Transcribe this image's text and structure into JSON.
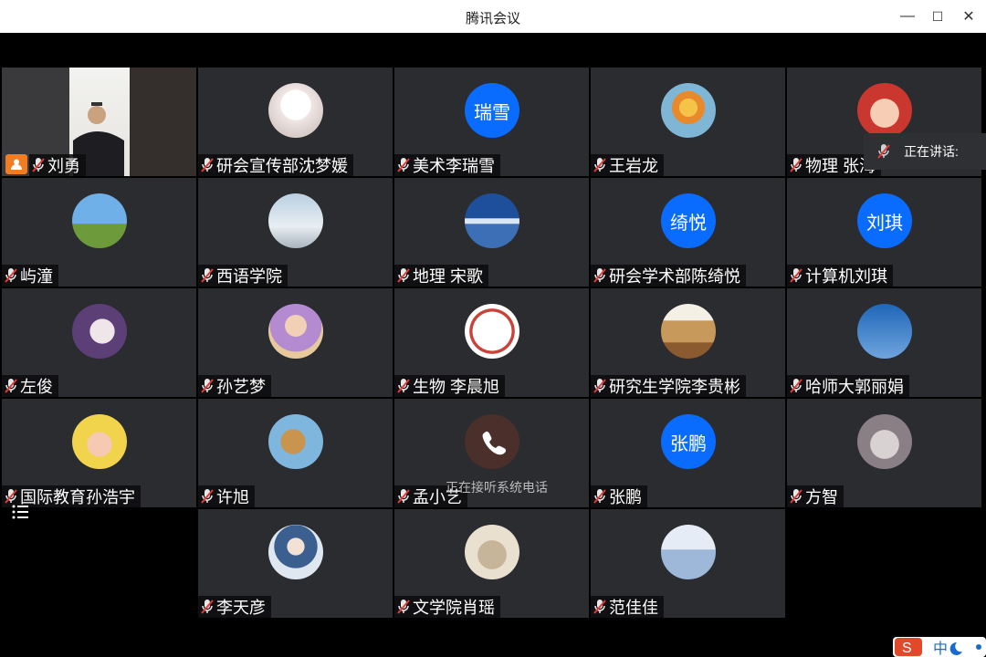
{
  "window": {
    "title": "腾讯会议",
    "minimize_label": "—",
    "maximize_label": "☐",
    "close_label": "✕"
  },
  "speaking": {
    "label": "正在讲话:"
  },
  "call_status": {
    "text": "正在接听系统电话"
  },
  "ime": {
    "label": "中"
  },
  "colors": {
    "tile": "#2b2c30",
    "accent": "#0a6cff",
    "host_badge": "#f07c24"
  },
  "participants": [
    {
      "name": "刘勇",
      "avatar": "host-video"
    },
    {
      "name": "研会宣传部沈梦媛",
      "avatar": "anime-girl-photo"
    },
    {
      "name": "美术李瑞雪",
      "avatar": "text",
      "avatar_text": "瑞雪"
    },
    {
      "name": "王岩龙",
      "avatar": "cartoon-photo"
    },
    {
      "name": "物理 张海",
      "avatar": "baby-photo"
    },
    {
      "name": "屿潼",
      "avatar": "pagoda-photo"
    },
    {
      "name": "西语学院",
      "avatar": "snow-tree-photo"
    },
    {
      "name": "地理 宋歌",
      "avatar": "lake-photo"
    },
    {
      "name": "研会学术部陈绮悦",
      "avatar": "text",
      "avatar_text": "绮悦"
    },
    {
      "name": "计算机刘琪",
      "avatar": "text",
      "avatar_text": "刘琪"
    },
    {
      "name": "左俊",
      "avatar": "anime-photo"
    },
    {
      "name": "孙艺梦",
      "avatar": "princess-photo"
    },
    {
      "name": "生物 李晨旭",
      "avatar": "seal-photo"
    },
    {
      "name": "研究生学院李贵彬",
      "avatar": "desert-photo"
    },
    {
      "name": "哈师大郭丽娟",
      "avatar": "birds-photo"
    },
    {
      "name": "国际教育孙浩宇",
      "avatar": "manga-photo"
    },
    {
      "name": "许旭",
      "avatar": "camel-photo"
    },
    {
      "name": "孟小艺",
      "avatar": "phone-call"
    },
    {
      "name": "张鹏",
      "avatar": "text",
      "avatar_text": "张鹏"
    },
    {
      "name": "方智",
      "avatar": "cat-photo"
    },
    {
      "name": "李天彦",
      "avatar": "character-photo"
    },
    {
      "name": "文学院肖瑶",
      "avatar": "kitten-photo"
    },
    {
      "name": "范佳佳",
      "avatar": "beach-photo"
    }
  ]
}
